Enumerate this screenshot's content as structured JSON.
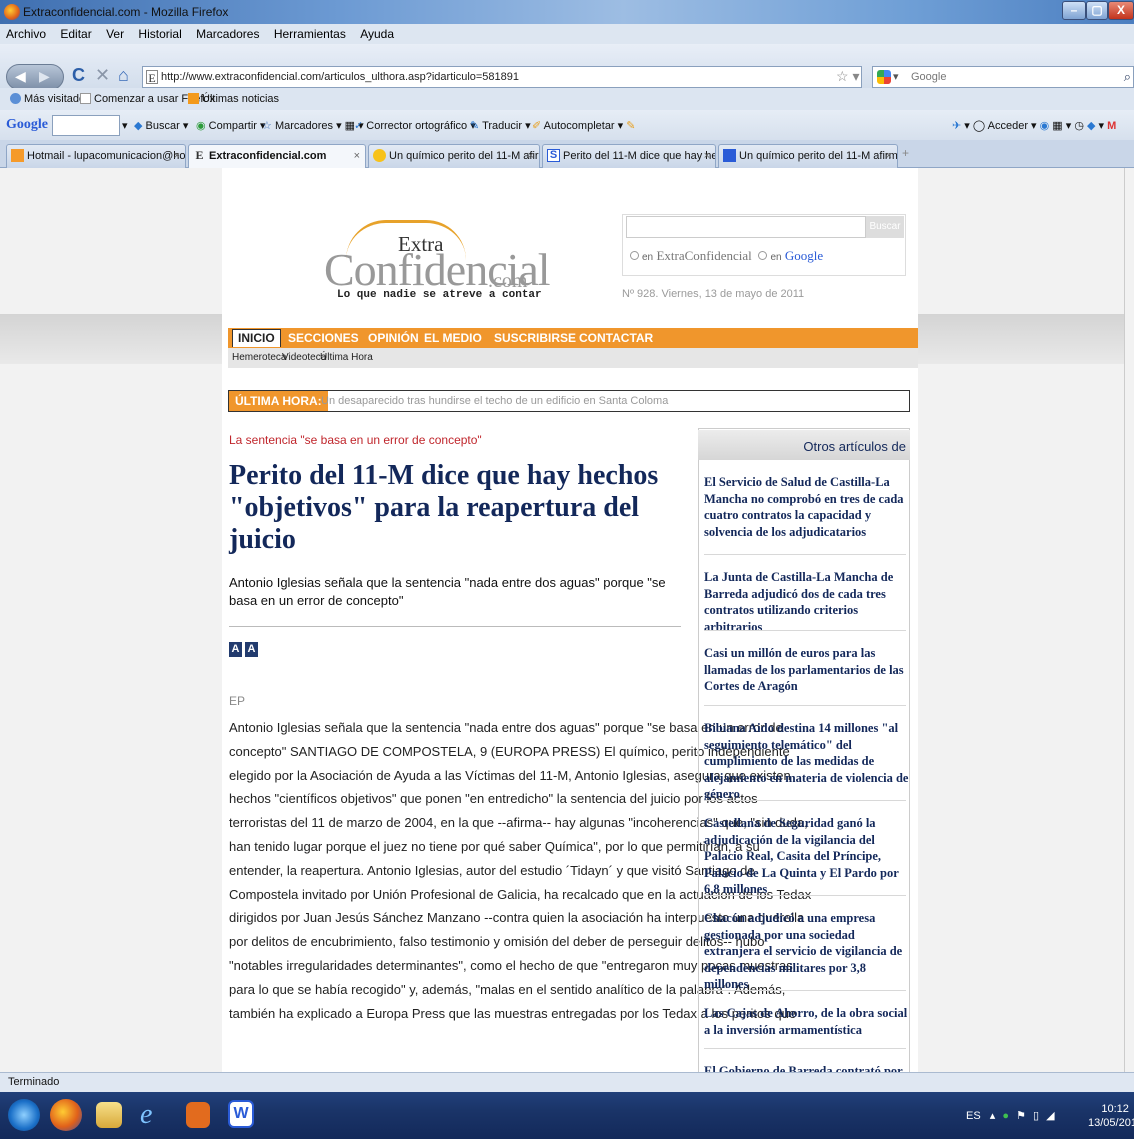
{
  "window": {
    "title": "Extraconfidencial.com - Mozilla Firefox",
    "min": "–",
    "max": "▢",
    "close": "X"
  },
  "menu": [
    "Archivo",
    "Editar",
    "Ver",
    "Historial",
    "Marcadores",
    "Herramientas",
    "Ayuda"
  ],
  "nav": {
    "url": "http://www.extraconfidencial.com/articulos_ulthora.asp?idarticulo=581891",
    "search_placeholder": "Google"
  },
  "bookmarks": [
    "Más visitados",
    "Comenzar a usar Firefox",
    "Últimas noticias"
  ],
  "gtoolbar": {
    "logo": "Google",
    "items": [
      "Buscar",
      "Compartir",
      "Marcadores",
      "Corrector ortográfico",
      "Traducir",
      "Autocompletar"
    ],
    "right": [
      "Acceder"
    ]
  },
  "tabs": [
    {
      "label": "Hotmail - lupacomunicacion@hot...",
      "active": false
    },
    {
      "label": "Extraconfidencial.com",
      "active": true
    },
    {
      "label": "Un químico perito del 11-M afirma ...",
      "active": false
    },
    {
      "label": "Perito del 11-M dice que hay hecho...",
      "active": false
    },
    {
      "label": "Un químico perito del 11-M afirma ...",
      "active": false
    }
  ],
  "site": {
    "logo_extra": "Extra",
    "logo_conf": "Confidencial",
    "logo_com": ".com",
    "tagline": "Lo que nadie se atreve a contar",
    "search_button": "Buscar",
    "radio1_prefix": "en",
    "radio1": "ExtraConfidencial",
    "radio2_prefix": "en",
    "radio2": "Google",
    "edition": "Nº 928. Viernes, 13 de mayo de 2011",
    "nav": [
      "INICIO",
      "SECCIONES",
      "OPINIÓN",
      "EL MEDIO",
      "SUSCRIBIRSE",
      "CONTACTAR"
    ],
    "subnav": [
      "Hemeroteca",
      "Videoteca",
      "Última Hora"
    ],
    "ultima_label": "ÚLTIMA HORA:",
    "ultima_text": "Un desaparecido tras hundirse el techo de un edificio en Santa Coloma"
  },
  "article": {
    "kicker": "La sentencia \"se basa en un error de concepto\"",
    "headline": "Perito del 11-M dice que hay hechos \"objetivos\" para la reapertura del juicio",
    "lead": "Antonio Iglesias señala que la sentencia \"nada entre dos aguas\" porque \"se basa en un error de concepto\"",
    "font_up": "A",
    "font_down": "A",
    "byline": "EP",
    "body_lines": [
      "Antonio Iglesias señala que la sentencia \"nada entre dos aguas\" porque \"se basa en un error de",
      "concepto\" SANTIAGO DE COMPOSTELA, 9 (EUROPA PRESS) El químico, perito independiente",
      "elegido por la Asociación de Ayuda a las Víctimas del 11-M, Antonio Iglesias, asegura que existen",
      "hechos \"científicos objetivos\" que ponen \"en entredicho\" la sentencia del juicio por los actos",
      "terroristas del 11 de marzo de 2004, en la que --afirma-- hay algunas \"incoherencias\" que, \"sin duda,",
      "han tenido lugar porque el juez no tiene por qué saber Química\", por lo que permitirían, a su",
      "entender, la reapertura. Antonio Iglesias, autor del estudio ´Tidayn´ y que visitó Santiago de",
      "Compostela invitado por Unión Profesional de Galicia, ha recalcado que en la actuación de los Tedax",
      "dirigidos por Juan Jesús Sánchez Manzano --contra quien la asociación ha interpuesto una querella",
      "por delitos de encubrimiento, falso testimonio y omisión del deber de perseguir delitos-- hubo",
      "\"notables irregularidades determinantes\", como el hecho de que \"entregaron muy pocas muestras",
      "para lo que se había recogido\" y, además, \"malas en el sentido analítico de la palabra\". Además,",
      "también ha explicado a Europa Press que las muestras entregadas por los Tedax a los peritos que"
    ]
  },
  "sidebar": {
    "title": "Otros artículos de",
    "links": [
      "El Servicio de Salud de Castilla-La Mancha no comprobó en tres de cada cuatro contratos la capacidad y solvencia de los adjudicatarios",
      "La Junta de Castilla-La Mancha de Barreda adjudicó dos de cada tres contratos utilizando criterios arbitrarios",
      "Casi un millón de euros para las llamadas de los parlamentarios de las Cortes de Aragón",
      "Bibiana Aido destina 14 millones \"al seguimiento telemático\" del cumplimiento de las medidas de alejamiento en materia de violencia de género",
      "Castellana de Seguridad ganó la adjudicación de la vigilancia del Palacio Real, Casita del Príncipe, Palacio de La Quinta y El Pardo por 6,8 millones",
      "Chacón adjudicó a una empresa gestionada por una sociedad extranjera el servicio de vigilancia de dependencias militares por 3,8 millones",
      "Las Cajas de Ahorro, de la obra social a la inversión armamentística",
      "El Gobierno de Barreda contrató por más"
    ]
  },
  "status": "Terminado",
  "tray": {
    "lang": "ES",
    "time": "10:12",
    "date": "13/05/2011"
  }
}
